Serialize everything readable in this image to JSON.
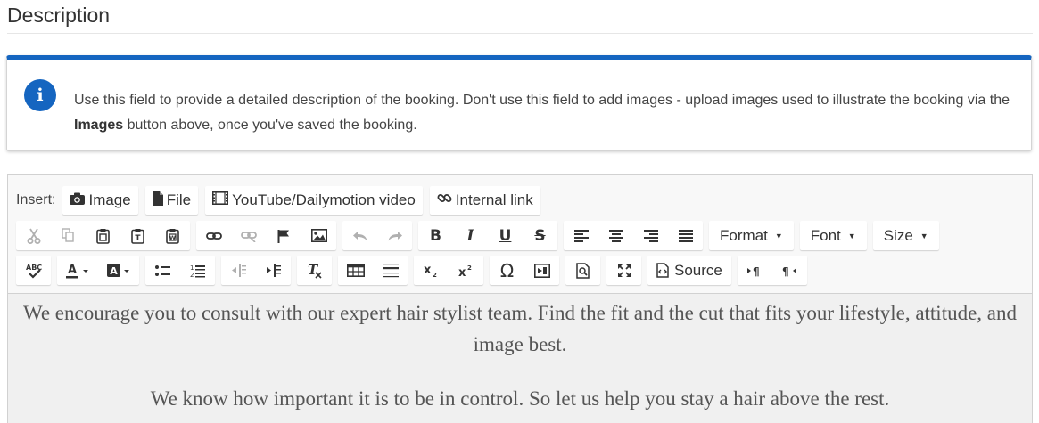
{
  "heading": "Description",
  "info": {
    "text_before": "Use this field to provide a detailed description of the booking. Don't use this field to add images - upload images used to illustrate the booking via the ",
    "bold": "Images",
    "text_after": " button above, once you've saved the booking.",
    "icon": "info-icon"
  },
  "toolbar": {
    "insert_label": "Insert:",
    "insert": {
      "image": "Image",
      "file": "File",
      "video": "YouTube/Dailymotion video",
      "link": "Internal link"
    },
    "format": "Format",
    "font": "Font",
    "size": "Size",
    "source": "Source"
  },
  "content": {
    "p1": "We encourage you to consult with our expert hair stylist team. Find the fit and the cut that fits your lifestyle, attitude, and image best.",
    "p2": "We know how important it is to be in control. So let us help you stay a hair above the rest."
  },
  "colors": {
    "accent": "#1565c0"
  }
}
